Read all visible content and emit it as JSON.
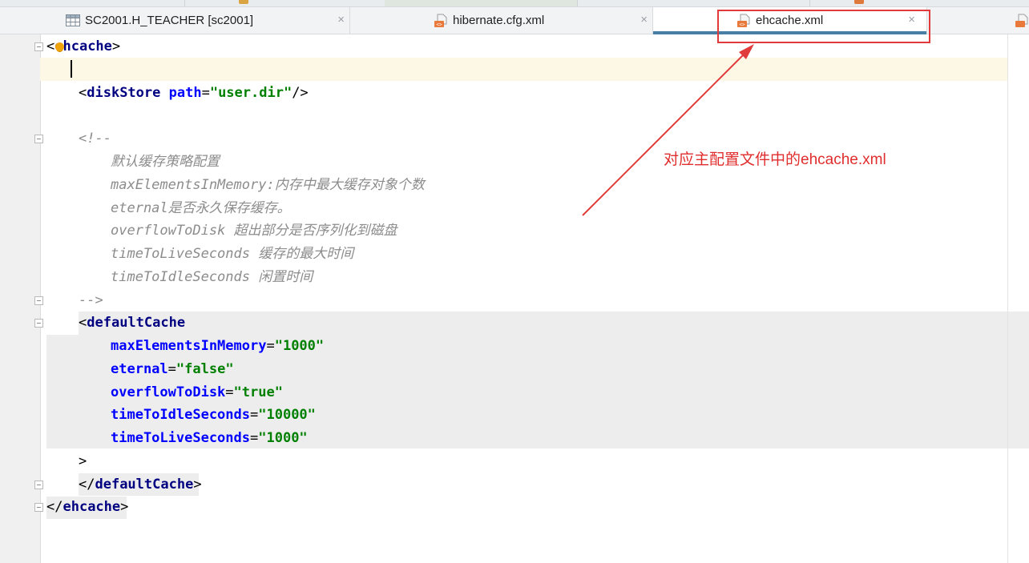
{
  "tabs": [
    {
      "label": "SC2001.H_TEACHER [sc2001]",
      "icon": "table-icon",
      "active": false
    },
    {
      "label": "hibernate.cfg.xml",
      "icon": "xml-file-icon",
      "active": false
    },
    {
      "label": "ehcache.xml",
      "icon": "xml-file-icon",
      "active": true
    }
  ],
  "tab_close_glyph": "×",
  "code": {
    "line_ehcache_open": "ehcache",
    "diskStore_tag": "diskStore",
    "diskStore_attr": "path",
    "diskStore_val": "\"user.dir\"",
    "comment_open": "<!--",
    "comment_lines": [
      "默认缓存策略配置",
      "maxElementsInMemory:内存中最大缓存对象个数",
      "eternal是否永久保存缓存。",
      "overflowToDisk 超出部分是否序列化到磁盘",
      "timeToLiveSeconds 缓存的最大时间",
      "timeToIdleSeconds 闲置时间"
    ],
    "comment_close": "-->",
    "defaultCache_tag": "defaultCache",
    "attributes": [
      {
        "name": "maxElementsInMemory",
        "value": "\"1000\""
      },
      {
        "name": "eternal",
        "value": "\"false\""
      },
      {
        "name": "overflowToDisk",
        "value": "\"true\""
      },
      {
        "name": "timeToIdleSeconds",
        "value": "\"10000\""
      },
      {
        "name": "timeToLiveSeconds",
        "value": "\"1000\""
      }
    ],
    "defaultCache_close": "defaultCache",
    "ehcache_close": "ehcache"
  },
  "annotation": {
    "text": "对应主配置文件中的ehcache.xml",
    "color": "#e02d2d"
  },
  "colors": {
    "tag": "#000080",
    "attr": "#0000ff",
    "value": "#008000",
    "comment": "#8c8c8c",
    "active_tab_underline": "#4a7fa5"
  }
}
